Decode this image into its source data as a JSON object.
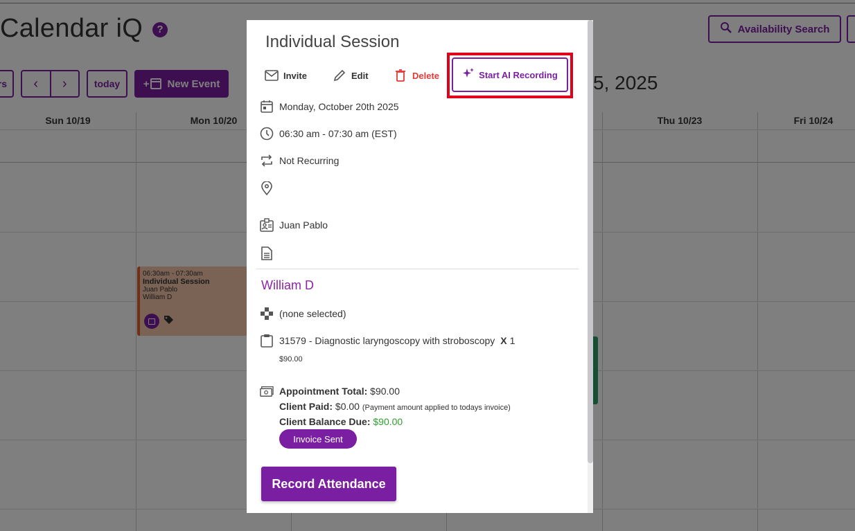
{
  "app": {
    "title": "Calendar iQ",
    "help_icon": "question-circle-icon",
    "availability_search_label": "Availability Search",
    "nav_partial_label": "rs",
    "today_label": "today",
    "new_event_label": "New Event",
    "date_range_partial": "5, 2025",
    "accent_color": "#7b1fa2"
  },
  "calendar": {
    "columns": [
      "Sun 10/19",
      "Mon 10/20",
      "",
      "",
      "Thu 10/23",
      "Fri 10/24"
    ],
    "event": {
      "time": "06:30am - 07:30am",
      "title": "Individual Session",
      "provider": "Juan Pablo",
      "client": "William D"
    }
  },
  "modal": {
    "title": "Individual Session",
    "actions": {
      "invite": "Invite",
      "edit": "Edit",
      "delete": "Delete",
      "start_ai_recording": "Start AI Recording"
    },
    "details": {
      "date": "Monday, October 20th 2025",
      "time": "06:30 am - 07:30 am (EST)",
      "recurrence": "Not Recurring",
      "location": "",
      "provider": "Juan Pablo",
      "notes": ""
    },
    "client": {
      "name": "William D",
      "service_selection": "(none selected)",
      "procedure_code": "31579 - Diagnostic laryngoscopy with stroboscopy",
      "procedure_x": "X",
      "procedure_qty": "1",
      "procedure_price": "$90.00"
    },
    "totals": {
      "appointment_total_label": "Appointment Total:",
      "appointment_total": "$90.00",
      "client_paid_label": "Client Paid:",
      "client_paid": "$0.00",
      "client_paid_note": "(Payment amount applied to todays invoice)",
      "balance_due_label": "Client Balance Due:",
      "balance_due": "$90.00",
      "invoice_status": "Invoice Sent"
    },
    "record_attendance_label": "Record Attendance"
  }
}
